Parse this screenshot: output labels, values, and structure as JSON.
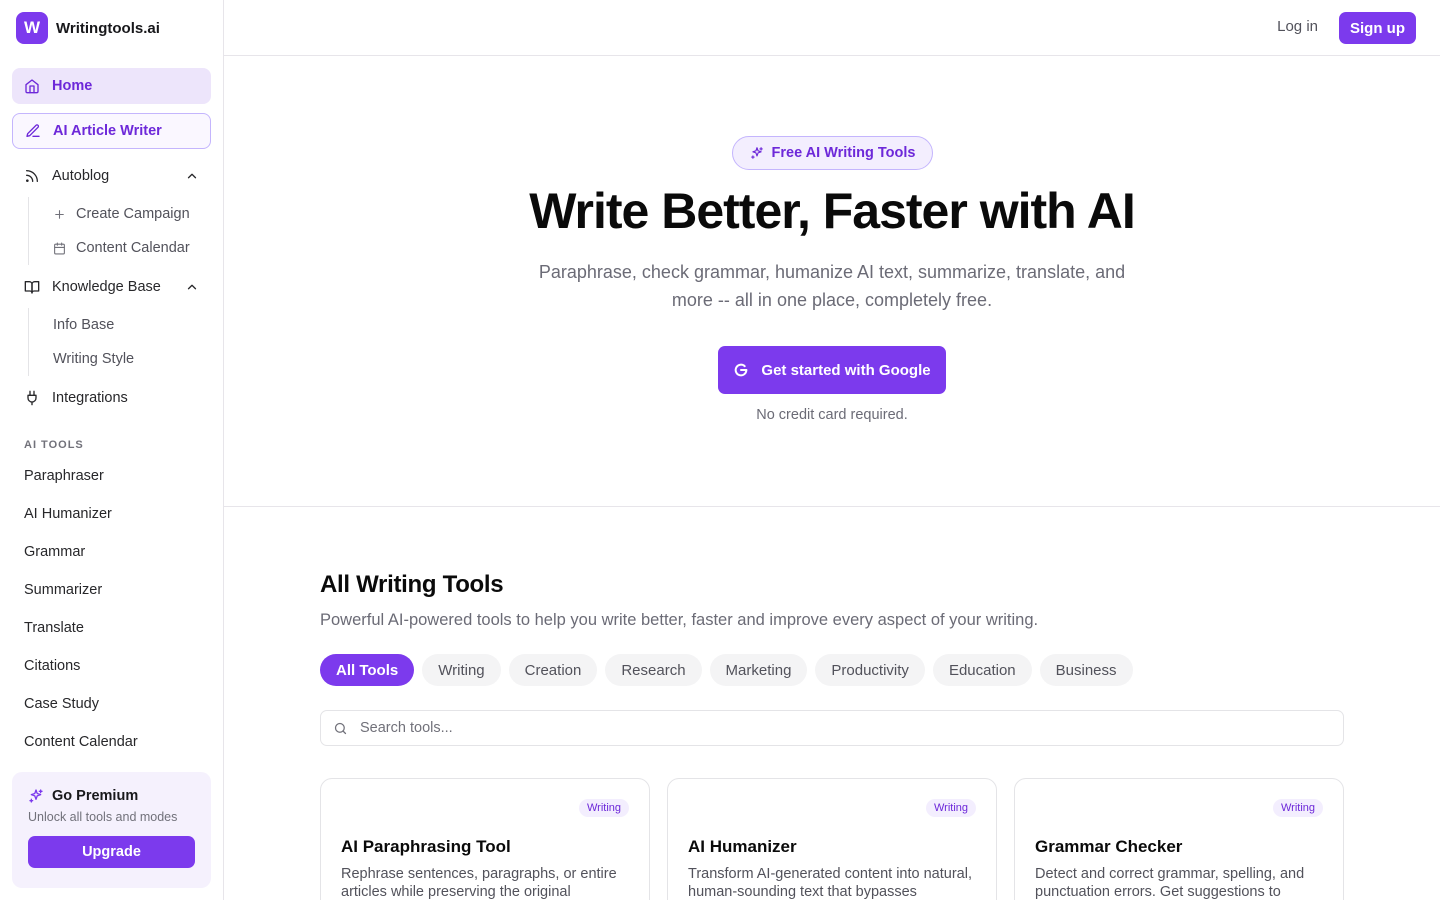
{
  "brand": {
    "logo_letter": "W",
    "name": "Writingtools.ai"
  },
  "nav": {
    "home": "Home",
    "article_writer": "AI Article Writer",
    "autoblog": "Autoblog",
    "create_campaign": "Create Campaign",
    "content_calendar": "Content Calendar",
    "knowledge_base": "Knowledge Base",
    "info_base": "Info Base",
    "writing_style": "Writing Style",
    "integrations": "Integrations"
  },
  "ai_tools": {
    "label": "AI TOOLS",
    "items": [
      "Paraphraser",
      "AI Humanizer",
      "Grammar",
      "Summarizer",
      "Translate",
      "Citations",
      "Case Study",
      "Content Calendar"
    ]
  },
  "premium": {
    "title": "Go Premium",
    "subtitle": "Unlock all tools and modes",
    "button": "Upgrade"
  },
  "topbar": {
    "login": "Log in",
    "signup": "Sign up"
  },
  "hero": {
    "badge": "Free AI Writing Tools",
    "title": "Write Better, Faster with AI",
    "subtitle": "Paraphrase, check grammar, humanize AI text, summarize, translate, and more -- all in one place, completely free.",
    "cta": "Get started with Google",
    "note": "No credit card required."
  },
  "tools_section": {
    "title": "All Writing Tools",
    "subtitle": "Powerful AI-powered tools to help you write better, faster and improve every aspect of your writing.",
    "filters": [
      "All Tools",
      "Writing",
      "Creation",
      "Research",
      "Marketing",
      "Productivity",
      "Education",
      "Business"
    ],
    "active_filter": "All Tools",
    "search_placeholder": "Search tools..."
  },
  "cards": [
    {
      "tag": "Writing",
      "title": "AI Paraphrasing Tool",
      "desc": "Rephrase sentences, paragraphs, or entire articles while preserving the original meaning."
    },
    {
      "tag": "Writing",
      "title": "AI Humanizer",
      "desc": "Transform AI-generated content into natural, human-sounding text that bypasses detectors."
    },
    {
      "tag": "Writing",
      "title": "Grammar Checker",
      "desc": "Detect and correct grammar, spelling, and punctuation errors. Get suggestions to improve."
    }
  ],
  "colors": {
    "accent": "#7c3aed",
    "accent_light": "#ede5fb"
  }
}
